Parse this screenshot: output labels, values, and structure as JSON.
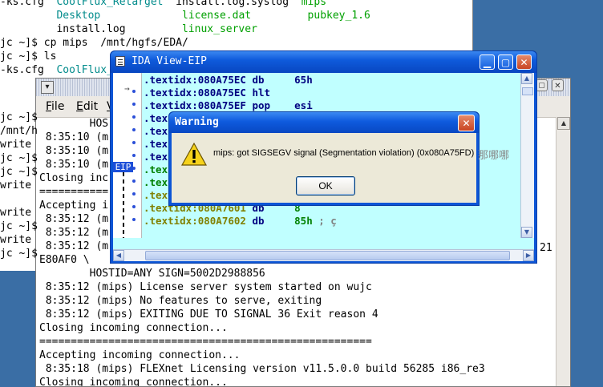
{
  "back_terminal": {
    "lines": [
      {
        "segments": [
          {
            "t": "-ks.cfg  ",
            "c": ""
          },
          {
            "t": "CoolFlux_Retarget  ",
            "c": "cyan"
          },
          {
            "t": "install.log.syslog  ",
            "c": ""
          },
          {
            "t": "mips",
            "c": "green"
          }
        ]
      },
      {
        "segments": [
          {
            "t": "         ",
            "c": ""
          },
          {
            "t": "Desktop             ",
            "c": "cyan"
          },
          {
            "t": "license.dat         ",
            "c": "green"
          },
          {
            "t": "pubkey_1.6",
            "c": "green"
          }
        ]
      },
      {
        "segments": [
          {
            "t": "         install.log         ",
            "c": ""
          },
          {
            "t": "linux_server",
            "c": "green"
          }
        ]
      },
      {
        "segments": [
          {
            "t": "jc ~]$ cp mips  /mnt/hgfs/EDA/",
            "c": ""
          }
        ]
      },
      {
        "segments": [
          {
            "t": "jc ~]$ ls",
            "c": ""
          }
        ]
      },
      {
        "segments": [
          {
            "t": "-ks.cfg  ",
            "c": ""
          },
          {
            "t": "CoolFlux_",
            "c": "cyan"
          }
        ]
      }
    ],
    "left_fragments": [
      "jc ~]$",
      "/mnt/h",
      "write",
      "jc ~]$",
      "jc ~]$",
      "write",
      "write",
      "jc ~]$",
      "write",
      "jc ~]$"
    ],
    "right_fragment": "21"
  },
  "front_terminal": {
    "menu": [
      "File",
      "Edit",
      "V"
    ],
    "lines": [
      "        HOS",
      " 8:35:10 (m",
      " 8:35:10 (m",
      " 8:35:10 (m",
      "Closing inc",
      "===========",
      "Accepting i",
      " 8:35:12 (m",
      " 8:35:12 (m",
      " 8:35:12 (m",
      "E80AF0 \\",
      "        HOSTID=ANY SIGN=5002D2988856",
      " 8:35:12 (mips) License server system started on wujc",
      " 8:35:12 (mips) No features to serve, exiting",
      " 8:35:12 (mips) EXITING DUE TO SIGNAL 36 Exit reason 4",
      "Closing incoming connection...",
      "=====================================================",
      "Accepting incoming connection...",
      " 8:35:18 (mips) FLEXnet Licensing version v11.5.0.0 build 56285 i86_re3",
      "Closing incoming connection..."
    ]
  },
  "ida": {
    "title": "IDA View-EIP",
    "eip_label": "EIP",
    "lines": [
      {
        "addr": ".textidx:080A75EC",
        "op": "db",
        "arg": "65h",
        "cmt": "",
        "color": "navy"
      },
      {
        "addr": ".textidx:080A75EC",
        "op": "hlt",
        "arg": "",
        "cmt": "",
        "color": "navy"
      },
      {
        "addr": ".textidx:080A75EF",
        "op": "pop",
        "arg": "esi",
        "cmt": "",
        "color": "navy"
      },
      {
        "addr": ".tex",
        "op": "",
        "arg": "",
        "cmt": "",
        "color": "navy"
      },
      {
        "addr": ".tex",
        "op": "",
        "arg": "",
        "cmt": "",
        "color": "navy"
      },
      {
        "addr": ".tex",
        "op": "",
        "arg": "",
        "cmt": "",
        "color": "navy"
      },
      {
        "addr": ".tex",
        "op": "",
        "arg": "",
        "cmt": "",
        "color": "navy"
      },
      {
        "addr": ".tex",
        "op": "",
        "arg": "",
        "cmt": "",
        "color": "green"
      },
      {
        "addr": ".tex",
        "op": "",
        "arg": "",
        "cmt": "",
        "color": "green"
      },
      {
        "addr": ".textidx:080A7600",
        "op": "db",
        "arg": "73h",
        "cmt": "; s",
        "color": "olive"
      },
      {
        "addr": ".textidx:080A7601",
        "op": "db",
        "arg": "8",
        "cmt": "",
        "color": "olive"
      },
      {
        "addr": ".textidx:080A7602",
        "op": "db",
        "arg": "85h",
        "cmt": "; ç",
        "color": "olive"
      }
    ]
  },
  "warning": {
    "title": "Warning",
    "message": "mips: got SIGSEGV signal (Segmentation violation) (0x080A75FD)",
    "ok_label": "OK"
  },
  "stray_text": "那哪哪"
}
